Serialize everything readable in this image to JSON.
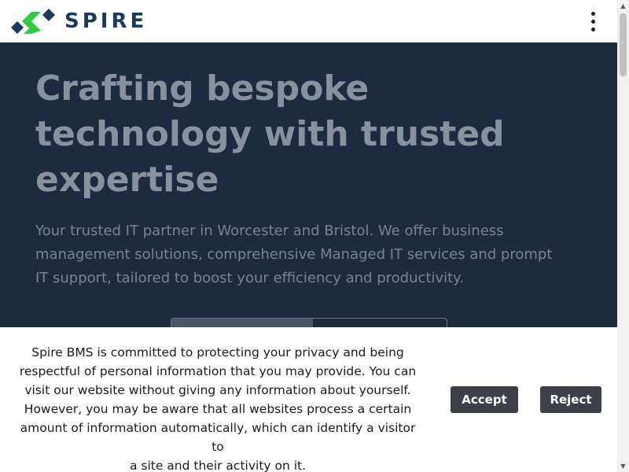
{
  "header": {
    "logo_text": "SPIRE",
    "menu_icon": "kebab-menu-icon"
  },
  "hero": {
    "title_lines": [
      "Crafting bespoke",
      "technology with trusted",
      "expertise"
    ],
    "subtitle_lines": [
      "Your trusted IT partner in Worcester and Bristol. We offer business",
      "management solutions, comprehensive Managed IT services and prompt",
      "IT support, tailored to boost your efficiency and productivity."
    ]
  },
  "cookie": {
    "text_lines": [
      "Spire BMS is committed to protecting your privacy and being",
      "respectful of personal information that you may provide. You can",
      "visit our website without giving any information about yourself.",
      "However, you may be aware that all websites process a certain",
      "amount of information automatically, which can identify a visitor to",
      "a site and their activity on it."
    ],
    "accept_label": "Accept",
    "reject_label": "Reject"
  },
  "colors": {
    "hero_bg": "#1e2a3f",
    "logo_green": "#2ecc40",
    "logo_navy": "#1b3a5c",
    "button_bg": "#3d4048"
  },
  "scrollbar": {
    "up_icon": "scroll-up-arrow-icon",
    "down_icon": "scroll-down-arrow-icon"
  }
}
